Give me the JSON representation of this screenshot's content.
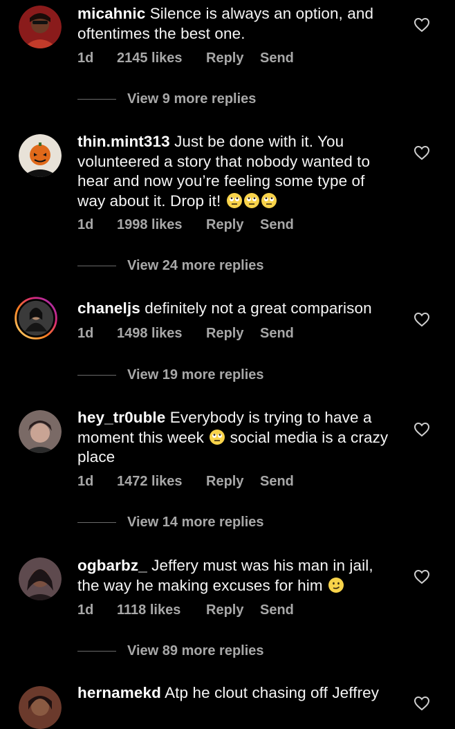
{
  "comments": [
    {
      "username": "micahnic",
      "text": "Silence is always an option, and oftentimes the best one.",
      "time": "1d",
      "likes": "2145 likes",
      "reply": "Reply",
      "send": "Send",
      "view_replies": "View 9 more replies"
    },
    {
      "username": "thin.mint313",
      "text": "Just be done with it. You volunteered a story that nobody wanted to hear and now you’re feeling some type of way about it. Drop it!",
      "emoji": "eye-roll-emoji x3",
      "time": "1d",
      "likes": "1998 likes",
      "reply": "Reply",
      "send": "Send",
      "view_replies": "View 24 more replies"
    },
    {
      "username": "chaneljs",
      "text": "definitely not a great comparison",
      "time": "1d",
      "likes": "1498 likes",
      "reply": "Reply",
      "send": "Send",
      "view_replies": "View 19 more replies"
    },
    {
      "username": "hey_tr0uble",
      "text_before": "Everybody is trying to have a moment this week",
      "text_after": "social media is a crazy place",
      "emoji": "eye-roll-emoji",
      "time": "1d",
      "likes": "1472 likes",
      "reply": "Reply",
      "send": "Send",
      "view_replies": "View 14 more replies"
    },
    {
      "username": "ogbarbz_",
      "text": "Jeffery must was his man in jail, the way he making excuses for him",
      "emoji": "smirk-emoji",
      "time": "1d",
      "likes": "1118 likes",
      "reply": "Reply",
      "send": "Send",
      "view_replies": "View 89 more replies"
    },
    {
      "username": "hernamekd",
      "text": "Atp he clout chasing off Jeffrey"
    }
  ],
  "colors": {
    "background": "#000000",
    "text": "#ffffff",
    "secondary_text": "#a8a8a8",
    "story_ring": "#d62976"
  },
  "icons": {
    "like": "heart-outline-icon"
  }
}
